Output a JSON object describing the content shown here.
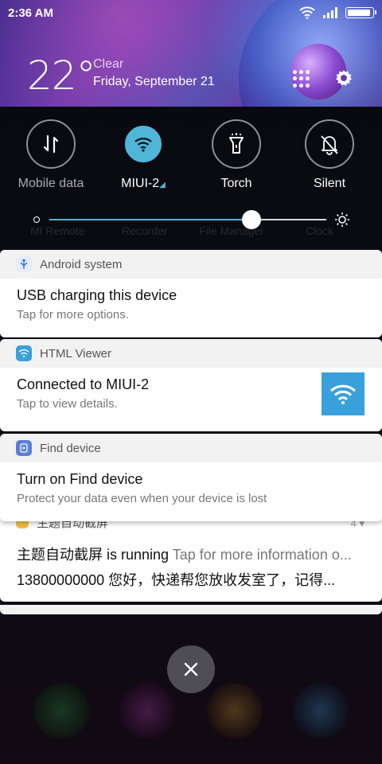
{
  "status_bar": {
    "time": "2:36 AM"
  },
  "weather": {
    "temperature": "22°",
    "condition": "Clear",
    "date": "Friday, September 21"
  },
  "background_apps": [
    "MI Remote",
    "Recorder",
    "File Manager",
    "Clock"
  ],
  "quick_toggles": [
    {
      "label": "Mobile data",
      "icon": "mobile-data-icon",
      "active": false
    },
    {
      "label": "MIUI-2",
      "icon": "wifi-icon",
      "active": true
    },
    {
      "label": "Torch",
      "icon": "torch-icon",
      "active": false
    },
    {
      "label": "Silent",
      "icon": "silent-bell-icon",
      "active": false
    }
  ],
  "brightness": {
    "level": 0.73
  },
  "notifications": [
    {
      "app": "Android system",
      "title": "USB charging this device",
      "subtitle": "Tap for more options."
    },
    {
      "app": "HTML Viewer",
      "title": "Connected to MIUI-2",
      "subtitle": "Tap to view details."
    },
    {
      "app": "Find device",
      "title": "Turn on Find device",
      "subtitle": "Protect your data even when your device is lost"
    },
    {
      "app": "主题自动截屏",
      "count": "4",
      "title": "主题自动截屏 is running",
      "title_extra": "Tap for more information o...",
      "subtitle": "13800000000 您好，快递帮您放收发室了，记得..."
    }
  ],
  "colors": {
    "accent": "#4fb6d8",
    "card_bg": "#ffffff",
    "card_header": "#f2f2f2"
  }
}
